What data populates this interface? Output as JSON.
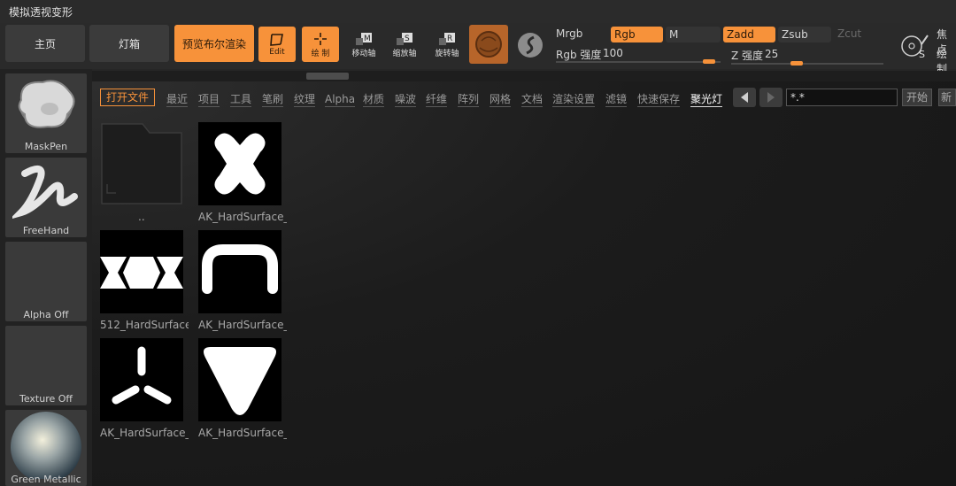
{
  "window": {
    "title": "模拟透视变形"
  },
  "toolbar": {
    "home": "主页",
    "lightbox": "灯箱",
    "bpr": "预览布尔渲染",
    "edit": "Edit",
    "draw": "绘 制",
    "move": "移动轴",
    "scale": "缩放轴",
    "rotate": "旋转轴",
    "move_key": "M",
    "scale_key": "S",
    "rotate_key": "R",
    "mrgb": "Mrgb",
    "rgb": "Rgb",
    "m": "M",
    "zadd": "Zadd",
    "zsub": "Zsub",
    "zcut": "Zcut",
    "rgb_intensity_label": "Rgb 强度",
    "rgb_intensity": "100",
    "z_intensity_label": "Z 强度",
    "z_intensity": "25",
    "focal_label": "焦点",
    "draw_label": "绘制",
    "brush_key": "S",
    "rgb_intensity_fill": 0.97,
    "z_intensity_fill": 0.43
  },
  "shelf": [
    {
      "name": "MaskPen"
    },
    {
      "name": "FreeHand"
    },
    {
      "name": "Alpha Off"
    },
    {
      "name": "Texture Off"
    },
    {
      "name": "Green Metallic"
    }
  ],
  "browser": {
    "tabs": [
      "打开文件",
      "最近",
      "项目",
      "工具",
      "笔刷",
      "纹理",
      "Alpha",
      "材质",
      "噪波",
      "纤维",
      "阵列",
      "网格",
      "文档",
      "渲染设置",
      "滤镜",
      "快速保存",
      "聚光灯"
    ],
    "filter": "*.*",
    "start": "开始",
    "new": "新建",
    "items": [
      {
        "caption": ".."
      },
      {
        "caption": "AK_HardSurface_"
      },
      {
        "caption": "512_HardSurface"
      },
      {
        "caption": "AK_HardSurface_"
      },
      {
        "caption": "AK_HardSurface_"
      },
      {
        "caption": "AK_HardSurface_"
      }
    ]
  },
  "colors": {
    "accent": "#f7923a",
    "panel": "#2a2a2a",
    "button": "#3b3b3b"
  }
}
